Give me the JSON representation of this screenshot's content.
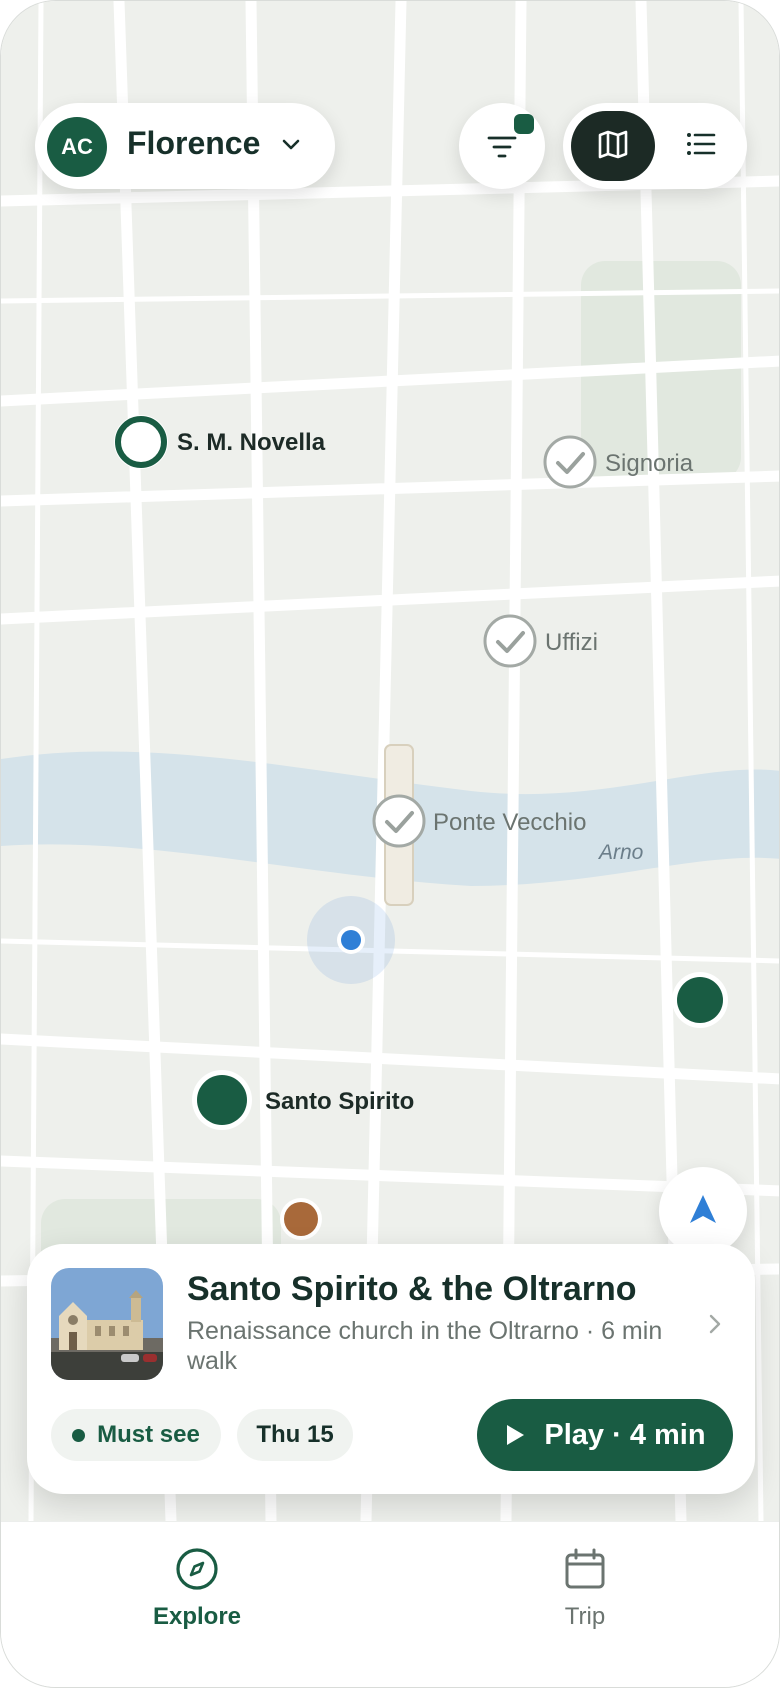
{
  "header": {
    "avatar_initials": "AC",
    "city": "Florence"
  },
  "view_toggle": {
    "active": "map"
  },
  "map": {
    "pins": [
      {
        "name": "S. M. Novella",
        "state": "upcoming"
      },
      {
        "name": "Signoria",
        "state": "visited"
      },
      {
        "name": "Uffizi",
        "state": "visited"
      },
      {
        "name": "Ponte Vecchio",
        "state": "visited"
      },
      {
        "name": "Santo Spirito",
        "state": "selected"
      }
    ],
    "river_label": "Arno"
  },
  "card": {
    "title": "Santo Spirito & the Oltrarno",
    "subtitle": "Renaissance church in the Oltrarno · 6 min walk",
    "chip_priority": "Must see",
    "chip_date": "Thu 15",
    "play_label": "Play · 4 min"
  },
  "nav": {
    "explore": "Explore",
    "trip": "Trip",
    "active": "explore"
  },
  "colors": {
    "brand_green": "#195c43",
    "visited_gray": "#9aa19d",
    "user_location": "#2f7fd6",
    "accent_orange": "#a8693a",
    "river": "#d5e3ea",
    "park": "#e1e8df"
  }
}
